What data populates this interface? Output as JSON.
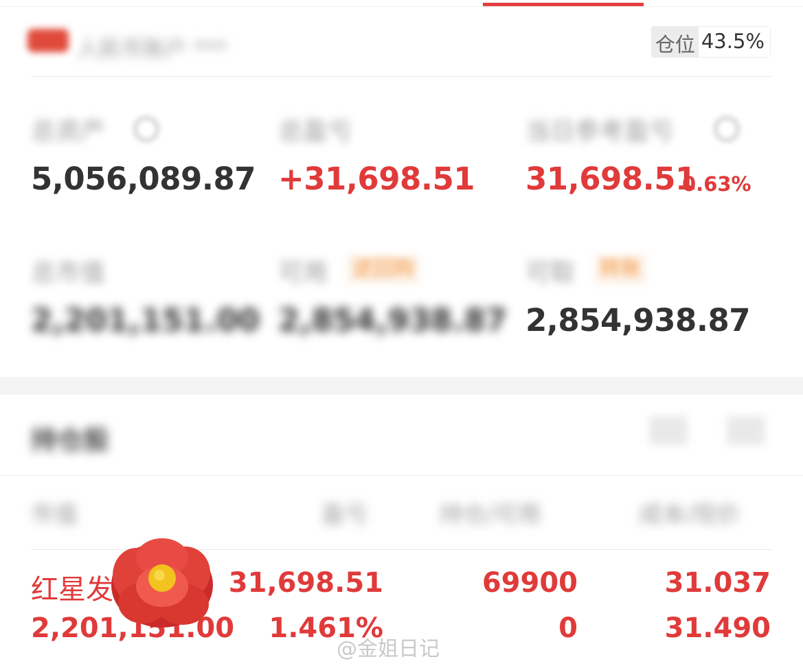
{
  "account": {
    "name": "人民币账户 ***",
    "position_label": "仓位",
    "position_value": "43.5%"
  },
  "summary": {
    "total_assets_label": "总资产",
    "total_assets": "5,056,089.87",
    "total_pnl_label": "总盈亏",
    "total_pnl": "+31,698.51",
    "today_pnl_label": "当日参考盈亏",
    "today_pnl": "31,698.51",
    "today_pnl_pct": "0.63%",
    "market_value_label": "总市值",
    "market_value": "2,201,151.00",
    "available_label": "可用",
    "available_tag": "逆回购",
    "available": "2,854,938.87",
    "withdrawable_label": "可取",
    "withdrawable_tag": "转账",
    "withdrawable": "2,854,938.87"
  },
  "holdings": {
    "title": "持仓股",
    "columns": [
      "市值",
      "盈亏",
      "持仓/可用",
      "成本/现价"
    ],
    "rows": [
      {
        "name": "红星发",
        "market_value": "2,201,151.00",
        "pnl": "31,698.51",
        "pnl_pct": "1.461%",
        "position": "69900",
        "available": "0",
        "cost": "31.037",
        "price": "31.490"
      }
    ]
  },
  "watermark": "@金姐日记",
  "colors": {
    "accent": "#e33f3f",
    "up": "#e03a3a",
    "tag": "#f39540",
    "text": "#333333",
    "muted": "#9b9b9b"
  }
}
